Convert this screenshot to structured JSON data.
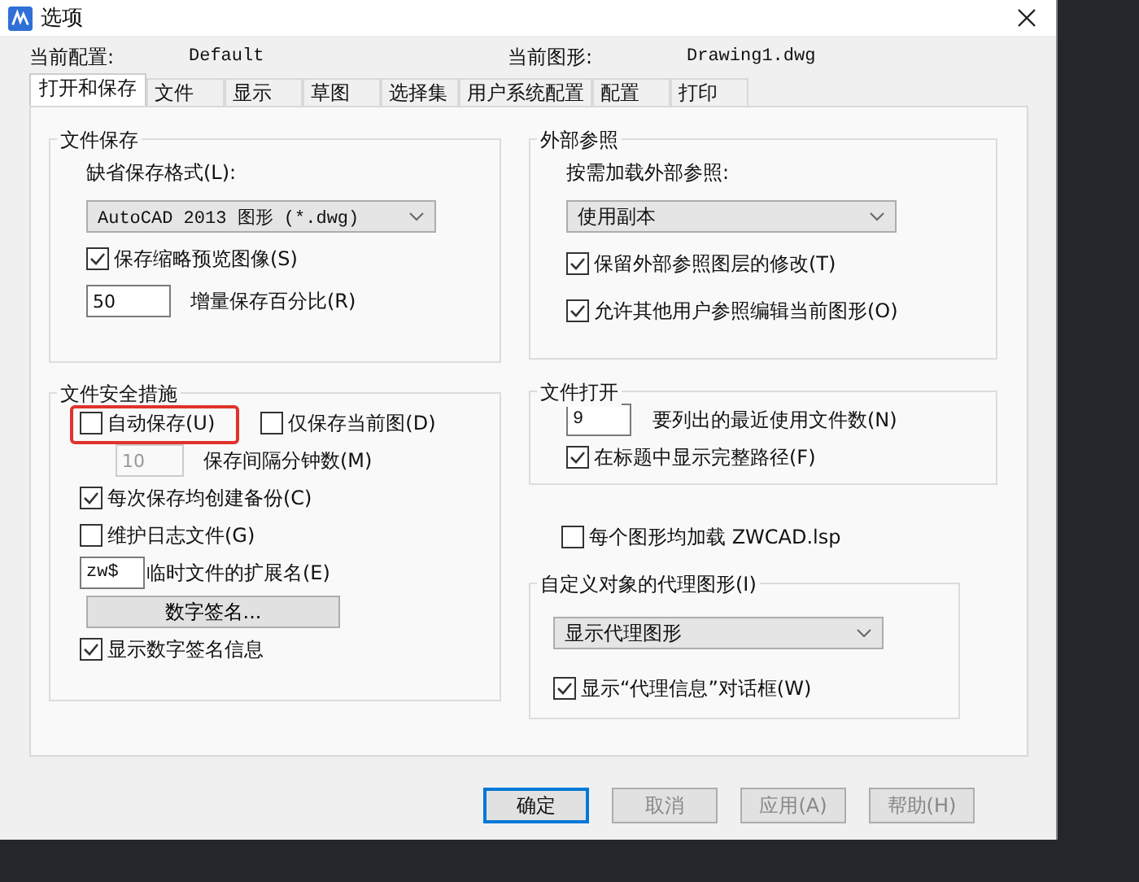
{
  "window": {
    "title": "选项"
  },
  "header": {
    "profile_label": "当前配置:",
    "profile": "Default",
    "drawing_label": "当前图形:",
    "drawing": "Drawing1.dwg"
  },
  "tabs": [
    {
      "label": "打开和保存",
      "selected": true
    },
    {
      "label": "文件",
      "selected": false
    },
    {
      "label": "显示",
      "selected": false
    },
    {
      "label": "草图",
      "selected": false
    },
    {
      "label": "选择集",
      "selected": false
    },
    {
      "label": "用户系统配置",
      "selected": false
    },
    {
      "label": "配置",
      "selected": false
    },
    {
      "label": "打印",
      "selected": false
    }
  ],
  "file_save": {
    "title": "文件保存",
    "format_label": "缺省保存格式(L):",
    "format": "AutoCAD 2013 图形 (*.dwg)",
    "thumbnail": {
      "label": "保存缩略预览图像(S)",
      "checked": true
    },
    "increment": {
      "value": "50",
      "label": "增量保存百分比(R)"
    }
  },
  "file_safety": {
    "title": "文件安全措施",
    "autosave": {
      "label": "自动保存(U)",
      "checked": false,
      "highlight": true
    },
    "current_only": {
      "label": "仅保存当前图(D)",
      "checked": false
    },
    "interval": {
      "value": "10",
      "label": "保存间隔分钟数(M)",
      "disabled": true
    },
    "backup": {
      "label": "每次保存均创建备份(C)",
      "checked": true
    },
    "log": {
      "label": "维护日志文件(G)",
      "checked": false
    },
    "temp_ext": {
      "value": "zw$",
      "label": "临时文件的扩展名(E)"
    },
    "signature_button": "数字签名...",
    "show_signature": {
      "label": "显示数字签名信息",
      "checked": true
    }
  },
  "xref": {
    "title": "外部参照",
    "demand_label": "按需加载外部参照:",
    "demand": "使用副本",
    "checks": [
      {
        "label": "保留外部参照图层的修改(T)",
        "checked": true
      },
      {
        "label": "允许其他用户参照编辑当前图形(O)",
        "checked": true
      }
    ]
  },
  "file_open": {
    "title": "文件打开",
    "recent": {
      "value": "9",
      "label": "要列出的最近使用文件数(N)"
    },
    "full_path": {
      "label": "在标题中显示完整路径(F)",
      "checked": true
    }
  },
  "load_lsp": {
    "label": "每个图形均加载 ZWCAD.lsp",
    "checked": false
  },
  "proxy": {
    "title": "自定义对象的代理图形(I)",
    "mode": "显示代理图形",
    "show_info": {
      "label": "显示“代理信息”对话框(W)",
      "checked": true
    }
  },
  "buttons": [
    {
      "label": "确定",
      "default": true
    },
    {
      "label": "取消",
      "default": false
    },
    {
      "label": "应用(A)",
      "default": false
    },
    {
      "label": "帮助(H)",
      "default": false
    }
  ]
}
